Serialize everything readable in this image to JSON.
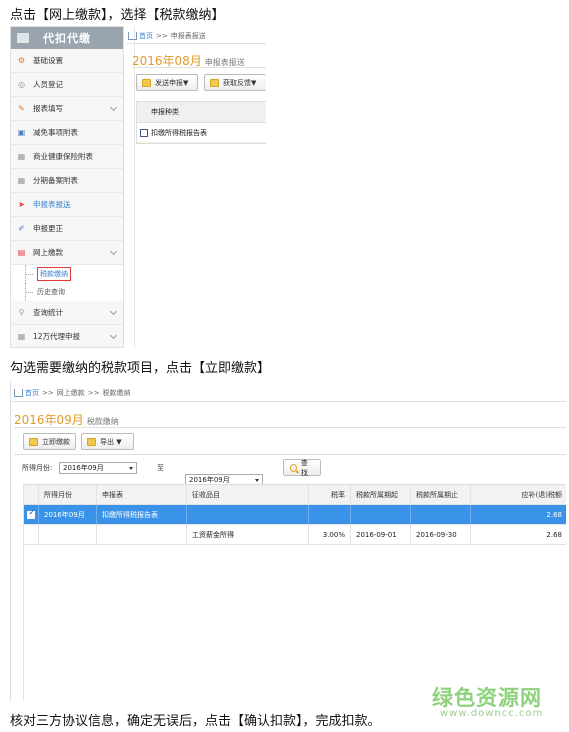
{
  "steps": {
    "step1": "点击【网上缴款】，选择【税款缴纳】",
    "step2": "勾选需要缴纳的税款项目，点击【立即缴款】",
    "step3": "核对三方协议信息，确定无误后，点击【确认扣款】，完成扣款。"
  },
  "shot1": {
    "sidebar": {
      "title": "代扣代缴",
      "items": [
        {
          "label": "基础设置",
          "icon": "gear-icon"
        },
        {
          "label": "人员登记",
          "icon": "person-icon"
        },
        {
          "label": "报表填写",
          "icon": "edit-icon",
          "chevron": true
        },
        {
          "label": "减免事项附表",
          "icon": "document-icon"
        },
        {
          "label": "商业健康保险附表",
          "icon": "grid-icon"
        },
        {
          "label": "分期备案附表",
          "icon": "grid-icon"
        },
        {
          "label": "申报表报送",
          "icon": "send-icon"
        },
        {
          "label": "申报更正",
          "icon": "pen-icon"
        },
        {
          "label": "网上缴款",
          "icon": "payment-icon",
          "chevron": true
        }
      ],
      "sub_items": [
        {
          "label": "税款缴纳",
          "selected": true
        },
        {
          "label": "历史查询",
          "selected": false
        }
      ],
      "items_after": [
        {
          "label": "查询统计",
          "icon": "search-icon",
          "chevron": true
        },
        {
          "label": "12万代理申报",
          "icon": "grid-icon",
          "chevron": true
        }
      ]
    },
    "breadcrumb": {
      "home": "首页",
      "sep": ">>",
      "current": "申报表报送"
    },
    "period": "2016年08月",
    "period_label": "申报表报送",
    "buttons": {
      "send": "发送申报▼",
      "feedback": "获取反馈▼"
    },
    "table": {
      "header": "申报种类",
      "rows": [
        "扣缴所得税报告表"
      ]
    }
  },
  "shot2": {
    "breadcrumb": {
      "home": "首页",
      "sep1": ">>",
      "mid": "网上缴款",
      "sep2": ">>",
      "current": "税款缴纳"
    },
    "period": "2016年09月",
    "period_label": "税款缴纳",
    "buttons": {
      "pay_now": "立即缴款",
      "export": "导出 ▼"
    },
    "filter": {
      "label": "所得月份:",
      "from": "2016年09月",
      "to_label": "至",
      "to": "2016年09月",
      "search": "查 找"
    },
    "columns": [
      "所得月份",
      "申报表",
      "征收品目",
      "税率",
      "税款所属期起",
      "税款所属期止",
      "应补(退)税额"
    ],
    "rows": [
      {
        "month": "2016年09月",
        "form": "扣缴所得税报告表",
        "item": "",
        "rate": "",
        "start": "",
        "end": "",
        "amount": "2.68",
        "checked": true
      },
      {
        "month": "",
        "form": "",
        "item": "工资薪金所得",
        "rate": "3.00%",
        "start": "2016-09-01",
        "end": "2016-09-30",
        "amount": "2.68",
        "checked": false
      }
    ]
  },
  "watermark": {
    "cn": "绿色资源网",
    "url": "www.downcc.com"
  },
  "colors": {
    "accent": "#3a93e8",
    "period": "#e29b2b",
    "highlight_box": "#e03b3b",
    "watermark": "#8fd27c"
  }
}
